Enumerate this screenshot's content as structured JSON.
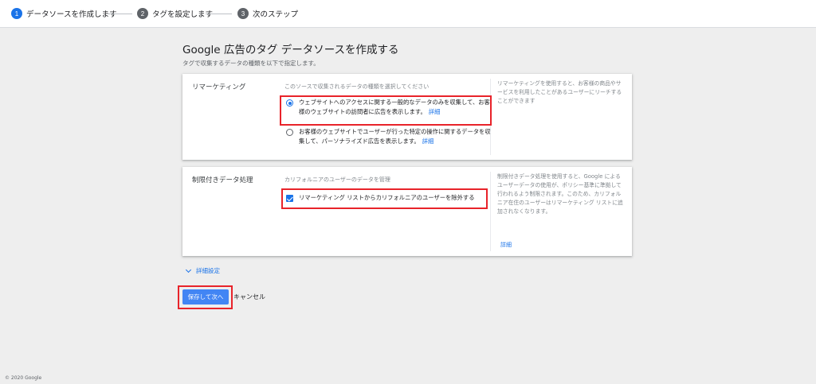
{
  "stepper": {
    "steps": [
      {
        "number": "1",
        "label": "データソースを作成します",
        "state": "active"
      },
      {
        "number": "2",
        "label": "タグを設定します",
        "state": "inactive"
      },
      {
        "number": "3",
        "label": "次のステップ",
        "state": "inactive"
      }
    ]
  },
  "page": {
    "title": "Google 広告のタグ データソースを作成する",
    "subtitle": "タグで収集するデータの種類を以下で指定します。"
  },
  "remarketing": {
    "title": "リマーケティング",
    "description": "このソースで収集されるデータの種類を選択してください",
    "options": [
      {
        "text": "ウェブサイトへのアクセスに関する一般的なデータのみを収集して、お客様のウェブサイトの訪問者に広告を表示します。",
        "link": "詳細",
        "selected": true
      },
      {
        "text": "お客様のウェブサイトでユーザーが行った特定の操作に関するデータを収集して、パーソナライズド広告を表示します。",
        "link": "詳細",
        "selected": false
      }
    ],
    "help": "リマーケティングを使用すると、お客様の商品やサービスを利用したことがあるユーザーにリーチすることができます"
  },
  "restricted": {
    "title": "制限付きデータ処理",
    "description": "カリフォルニアのユーザーのデータを管理",
    "checkbox_label": "リマーケティング リストからカリフォルニアのユーザーを除外する",
    "checked": true,
    "help": "制限付きデータ処理を使用すると、Google によるユーザーデータの使用が、ポリシー基準に準拠して行われるよう制限されます。このため、カリフォルニア在住のユーザーはリマーケティング リストに追加されなくなります。",
    "help_link": "詳細"
  },
  "advanced": {
    "label": "詳細設定"
  },
  "actions": {
    "save_label": "保存して次へ",
    "cancel_label": "キャンセル"
  },
  "footer": {
    "copyright": "© 2020 Google"
  },
  "colors": {
    "accent": "#1a73e8",
    "button": "#4285f4",
    "highlight": "#e8232a",
    "background": "#eeeeee"
  }
}
